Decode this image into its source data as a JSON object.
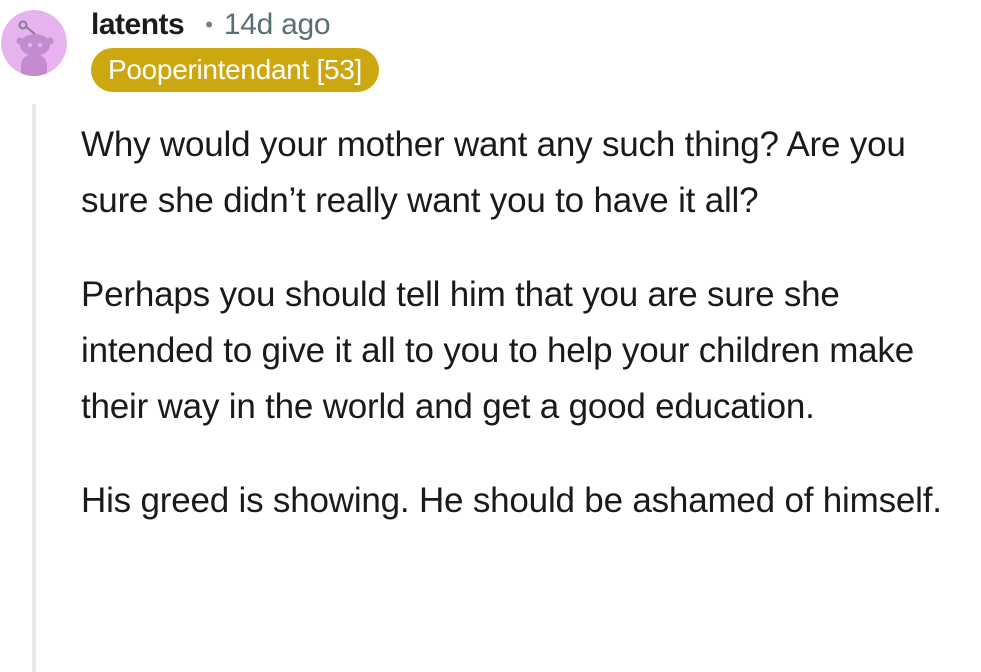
{
  "comment": {
    "author": "latents",
    "separator": "•",
    "timestamp": "14d ago",
    "flair": "Pooperintendant [53]",
    "paragraphs": [
      "Why would your mother want any such thing? Are you sure she didn’t really want you to have it all?",
      "Perhaps you should tell him that you are sure she intended to give it all to you to help your children make their way in the world and get a good education.",
      "His greed is showing. He should be ashamed of himself."
    ]
  },
  "colors": {
    "flair_background": "#cda710",
    "flair_text": "#ffffff",
    "avatar_background": "#e7b3ef",
    "thread_line": "#e5ebee",
    "timestamp": "#576f76"
  },
  "icons": {
    "avatar": "snoo-avatar-icon"
  }
}
